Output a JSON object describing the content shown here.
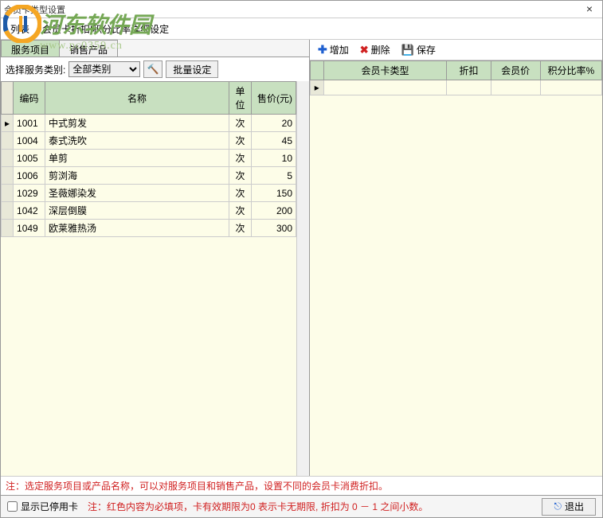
{
  "window": {
    "title": "会员卡类型设置"
  },
  "watermark": {
    "main": "河东软件园",
    "url": "www.pc0359.cn"
  },
  "menubar": {
    "item1": "列表",
    "item2": "会员卡折扣|积分比率详细设定"
  },
  "tabs": {
    "tab1": "服务项目",
    "tab2": "销售产品"
  },
  "filter": {
    "label": "选择服务类别:",
    "selected": "全部类别",
    "batch": "批量设定"
  },
  "left_table": {
    "headers": {
      "code": "编码",
      "name": "名称",
      "unit": "单位",
      "price": "售价(元)"
    },
    "rows": [
      {
        "code": "1001",
        "name": "中式剪发",
        "unit": "次",
        "price": "20"
      },
      {
        "code": "1004",
        "name": "泰式洗吹",
        "unit": "次",
        "price": "45"
      },
      {
        "code": "1005",
        "name": "单剪",
        "unit": "次",
        "price": "10"
      },
      {
        "code": "1006",
        "name": "剪浏海",
        "unit": "次",
        "price": "5"
      },
      {
        "code": "1029",
        "name": "圣薇娜染发",
        "unit": "次",
        "price": "150"
      },
      {
        "code": "1042",
        "name": "深层倒膜",
        "unit": "次",
        "price": "200"
      },
      {
        "code": "1049",
        "name": "欧莱雅热汤",
        "unit": "次",
        "price": "300"
      }
    ]
  },
  "toolbar": {
    "add": "增加",
    "delete": "删除",
    "save": "保存"
  },
  "right_table": {
    "headers": {
      "type": "会员卡类型",
      "discount": "折扣",
      "price": "会员价",
      "rate": "积分比率%"
    }
  },
  "footer": {
    "note1": "注：选定服务项目或产品名称，可以对服务项目和销售产品，设置不同的会员卡消费折扣。",
    "checkbox": "显示已停用卡",
    "note2": "注：红色内容为必填项，卡有效期限为0 表示卡无期限, 折扣为 0 － 1 之间小数。",
    "exit": "退出"
  }
}
